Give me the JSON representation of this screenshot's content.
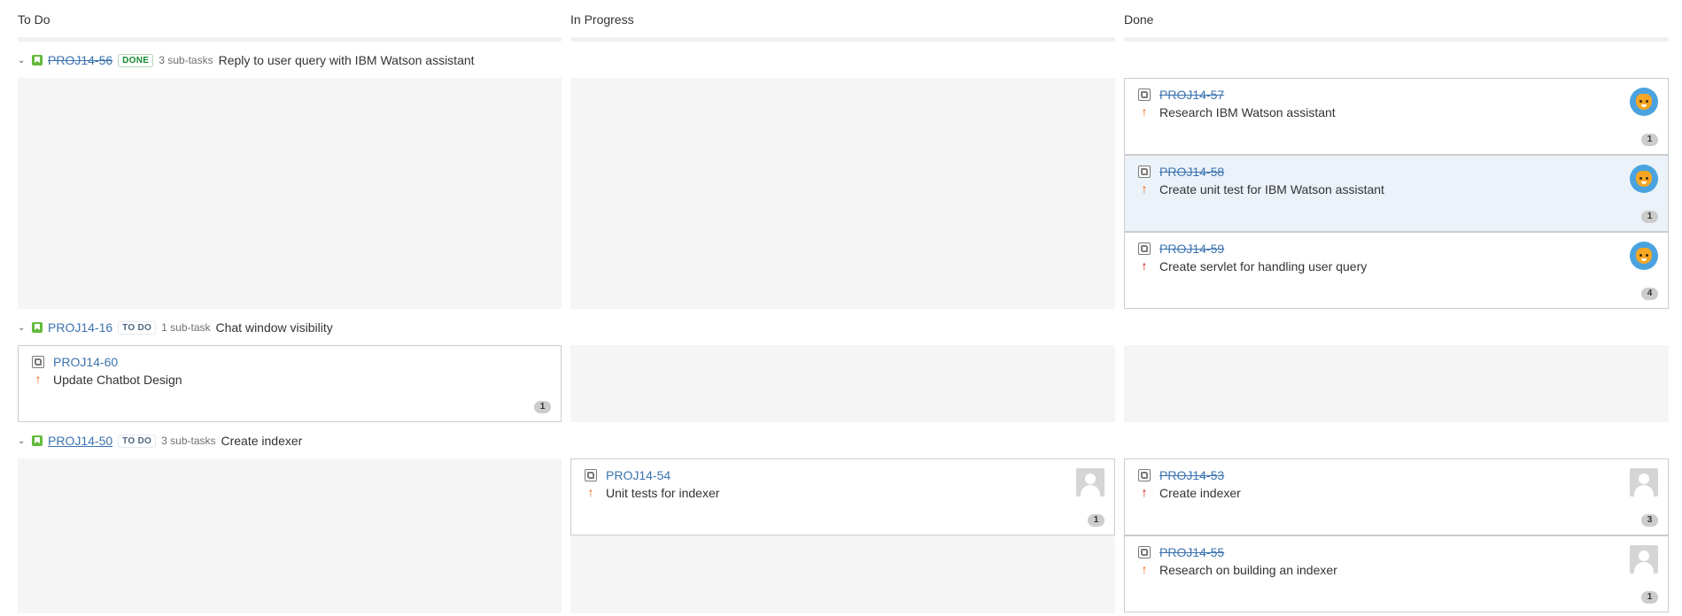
{
  "columns": [
    "To Do",
    "In Progress",
    "Done"
  ],
  "swimlanes": [
    {
      "key": "PROJ14-56",
      "status": "DONE",
      "subtasks": "3 sub-tasks",
      "summary": "Reply to user query with IBM Watson assistant",
      "cards": [
        {
          "key": "PROJ14-57",
          "summary": "Research IBM Watson assistant",
          "priority": "high",
          "badge": "1"
        },
        {
          "key": "PROJ14-58",
          "summary": "Create unit test for IBM Watson assistant",
          "priority": "high",
          "badge": "1"
        },
        {
          "key": "PROJ14-59",
          "summary": "Create servlet for handling user query",
          "priority": "highest",
          "badge": "4"
        }
      ]
    },
    {
      "key": "PROJ14-16",
      "status": "TO DO",
      "subtasks": "1 sub-task",
      "summary": "Chat window visibility",
      "cards": [
        {
          "key": "PROJ14-60",
          "summary": "Update Chatbot Design",
          "priority": "high",
          "badge": "1"
        }
      ]
    },
    {
      "key": "PROJ14-50",
      "status": "TO DO",
      "subtasks": "3 sub-tasks",
      "summary": "Create indexer",
      "cards": [
        {
          "key": "PROJ14-54",
          "summary": "Unit tests for indexer",
          "priority": "high",
          "badge": "1"
        },
        {
          "key": "PROJ14-53",
          "summary": "Create indexer",
          "priority": "highest",
          "badge": "3"
        },
        {
          "key": "PROJ14-55",
          "summary": "Research on building an indexer",
          "priority": "high",
          "badge": "1"
        }
      ]
    }
  ],
  "icons": {
    "priority_up": "↑",
    "chevron": "⌄"
  },
  "colors": {
    "link": "#3b73af",
    "done_lozenge": "#14892c",
    "todo_lozenge": "#4a6785",
    "priority_high": "#f15c00",
    "priority_highest": "#ce0000",
    "selected_card": "#ebf2f9"
  }
}
